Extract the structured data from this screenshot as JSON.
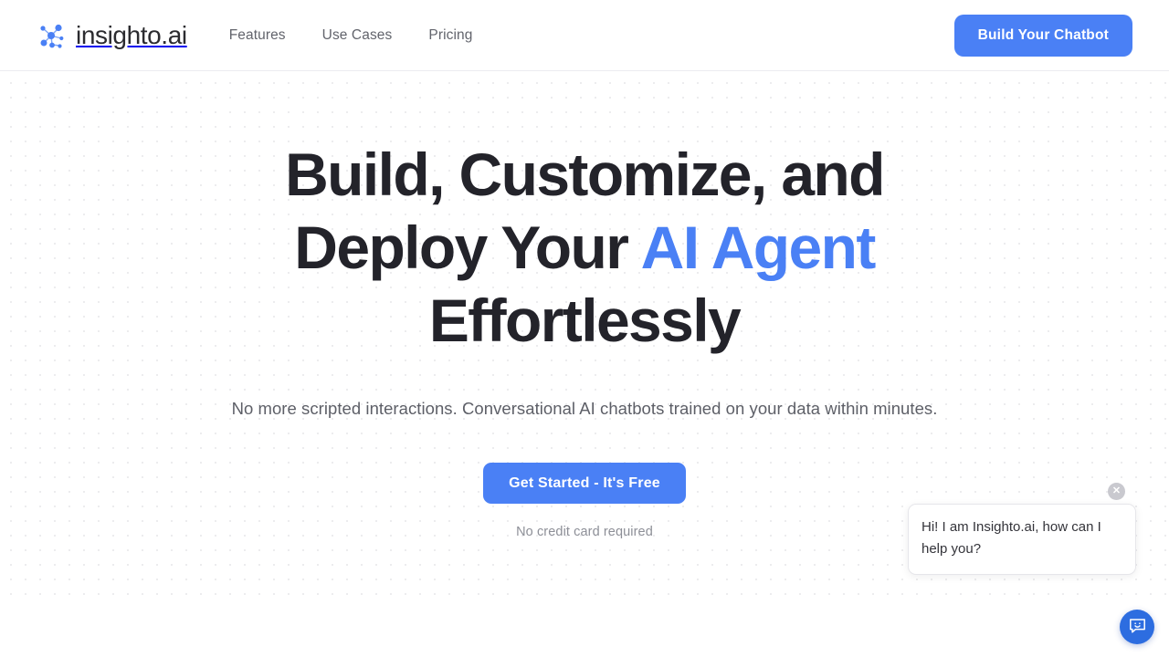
{
  "header": {
    "logo_icon": "network-nodes-logo-icon",
    "brand_name": "insighto.ai",
    "nav": [
      {
        "label": "Features"
      },
      {
        "label": "Use Cases"
      },
      {
        "label": "Pricing"
      }
    ],
    "cta_label": "Build Your Chatbot"
  },
  "hero": {
    "headline_part1": "Build, Customize, and Deploy Your ",
    "headline_accent": "AI Agent",
    "headline_part2": " Effortlessly",
    "subheadline": "No more scripted interactions. Conversational AI chatbots trained on your data within minutes.",
    "cta_label": "Get Started - It's Free",
    "cta_note": "No credit card required"
  },
  "chat_widget": {
    "greeting": "Hi! I am Insighto.ai, how can I help you?",
    "close_label": "✕",
    "launcher_icon": "chat-smiley-bubble-icon"
  },
  "colors": {
    "accent_blue": "#4a80f5",
    "launcher_blue": "#2d6de0",
    "headline_dark": "#23232a",
    "body_grey": "#5d5f67",
    "muted_grey": "#8d8f97",
    "nav_grey": "#62646c",
    "dot_pattern": "#ececee",
    "header_border": "#ececf0"
  }
}
